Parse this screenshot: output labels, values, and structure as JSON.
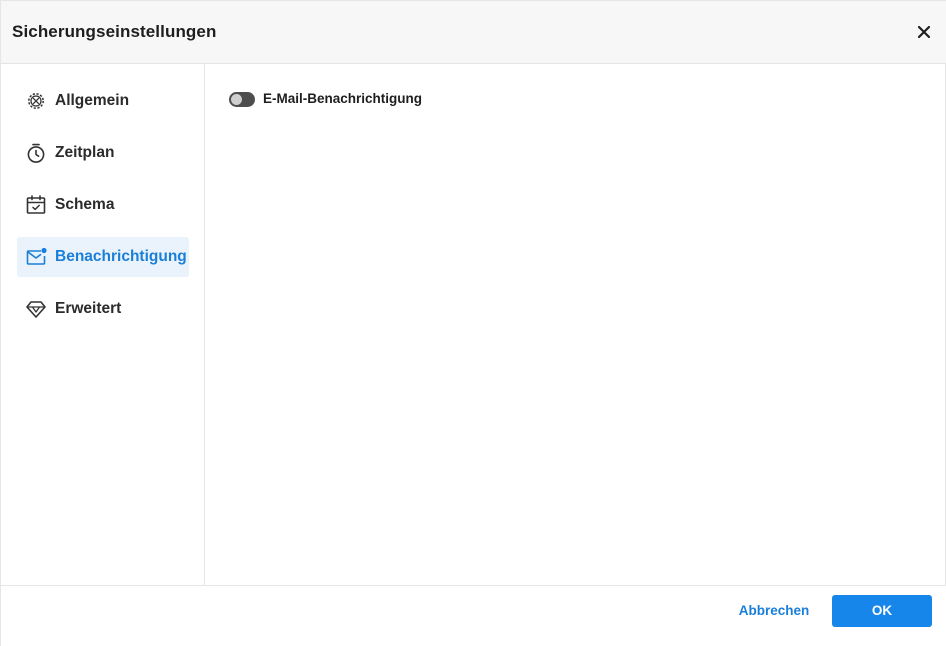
{
  "dialog": {
    "title": "Sicherungseinstellungen",
    "close_icon": "close-icon"
  },
  "sidebar": {
    "items": [
      {
        "label": "Allgemein",
        "icon": "gear-icon",
        "active": false
      },
      {
        "label": "Zeitplan",
        "icon": "stopwatch-icon",
        "active": false
      },
      {
        "label": "Schema",
        "icon": "calendar-check-icon",
        "active": false
      },
      {
        "label": "Benachrichtigung",
        "icon": "mail-notification-icon",
        "active": true
      },
      {
        "label": "Erweitert",
        "icon": "diamond-icon",
        "active": false
      }
    ]
  },
  "content": {
    "email_notification": {
      "label": "E-Mail-Benachrichtigung",
      "enabled": false
    }
  },
  "footer": {
    "cancel_label": "Abbrechen",
    "ok_label": "OK"
  },
  "colors": {
    "accent": "#1686ea",
    "active_text": "#1a7fd9",
    "active_bg": "#eaf3fc",
    "header_bg": "#f7f7f7",
    "toggle_off": "#4d4d4d"
  }
}
